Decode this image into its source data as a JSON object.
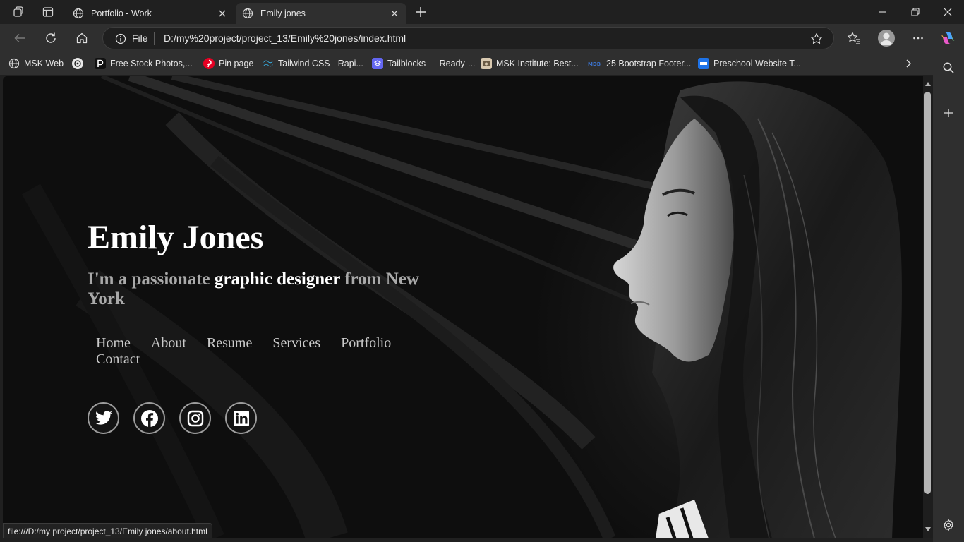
{
  "browser": {
    "tabs": [
      {
        "title": "Portfolio - Work",
        "active": false
      },
      {
        "title": "Emily jones",
        "active": true
      }
    ],
    "address": {
      "scheme_label": "File",
      "url": "D:/my%20project/project_13/Emily%20jones/index.html"
    },
    "favorites": [
      {
        "label": "MSK Web",
        "icon": "globe-icon"
      },
      {
        "label": "",
        "icon": "chatgpt-icon"
      },
      {
        "label": "Free Stock Photos,...",
        "icon": "pexels-icon"
      },
      {
        "label": "Pin page",
        "icon": "pinterest-icon"
      },
      {
        "label": "Tailwind CSS - Rapi...",
        "icon": "tailwind-icon"
      },
      {
        "label": "Tailblocks — Ready-...",
        "icon": "tailblocks-icon"
      },
      {
        "label": "MSK Institute: Best...",
        "icon": "msk-institute-icon"
      },
      {
        "label": "25 Bootstrap Footer...",
        "icon": "mdb-icon"
      },
      {
        "label": "Preschool Website T...",
        "icon": "preschool-icon"
      }
    ],
    "status_url": "file:///D:/my project/project_13/Emily jones/about.html",
    "accent": "#2f2f2f"
  },
  "page": {
    "name": "Emily Jones",
    "subtitle": {
      "pre": "I'm a passionate ",
      "highlight": "graphic designer",
      "post": " from New York"
    },
    "nav": [
      "Home",
      "About",
      "Resume",
      "Services",
      "Portfolio",
      "Contact"
    ],
    "socials": [
      "twitter-icon",
      "facebook-icon",
      "instagram-icon",
      "linkedin-icon"
    ]
  }
}
